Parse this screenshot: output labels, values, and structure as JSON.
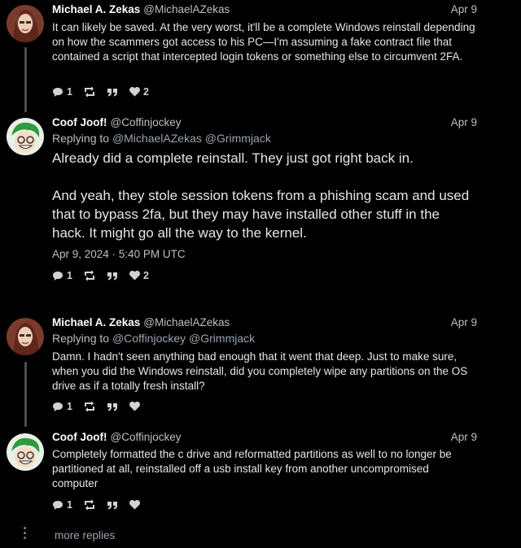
{
  "posts": [
    {
      "author": "Michael A. Zekas",
      "handle": "@MichaelAZekas",
      "date": "Apr 9",
      "replying_label": "",
      "replying_to": [],
      "text": "It can likely be saved. At the very worst, it'll be a complete Windows reinstall depending on how the scammers got access to his PC—I'm assuming a fake contract file that contained a script that intercepted login tokens or something else to circumvent 2FA.",
      "timestamp": "",
      "comments": "1",
      "retweets": "",
      "quotes": "",
      "likes": "2"
    },
    {
      "author": "Coof Joof!",
      "handle": "@Coffinjockey",
      "date": "Apr 9",
      "replying_label": "Replying to",
      "replying_to": [
        "@MichaelAZekas",
        "@Grimmjack"
      ],
      "text": "Already did a complete reinstall. They just got right back in.\n\nAnd yeah, they stole session tokens from a phishing scam and used that to bypass 2fa, but they may have installed other stuff in the hack. It might go all the way to the kernel.",
      "timestamp": "Apr 9, 2024 · 5:40 PM UTC",
      "comments": "1",
      "retweets": "",
      "quotes": "",
      "likes": "2"
    },
    {
      "author": "Michael A. Zekas",
      "handle": "@MichaelAZekas",
      "date": "Apr 9",
      "replying_label": "Replying to",
      "replying_to": [
        "@Coffinjockey",
        "@Grimmjack"
      ],
      "text": "Damn. I hadn't seen anything bad enough that it went that deep. Just to make sure, when you did the Windows reinstall, did you completely wipe any partitions on the OS drive as if a totally fresh install?",
      "timestamp": "",
      "comments": "1",
      "retweets": "",
      "quotes": "",
      "likes": ""
    },
    {
      "author": "Coof Joof!",
      "handle": "@Coffinjockey",
      "date": "Apr 9",
      "replying_label": "",
      "replying_to": [],
      "text": "Completely formatted the c drive and reformatted partitions as well to no longer be partitioned at all, reinstalled off a usb install key from another uncompromised computer",
      "timestamp": "",
      "comments": "1",
      "retweets": "",
      "quotes": "",
      "likes": ""
    }
  ],
  "more_replies": "more replies",
  "colors": {
    "background": "#000000",
    "thread_line": "#4a4f55",
    "link": "#9aa4ad"
  },
  "icons": [
    "comment-icon",
    "retweet-icon",
    "quote-icon",
    "heart-icon"
  ]
}
